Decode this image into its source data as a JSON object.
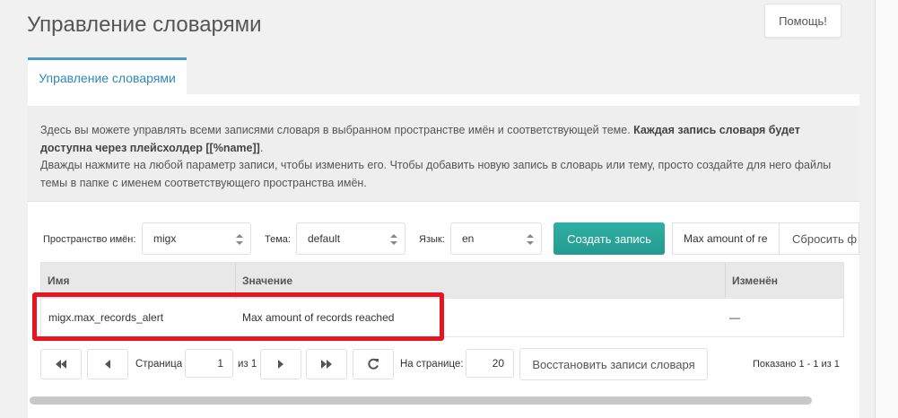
{
  "header": {
    "title": "Управление словарями",
    "help_label": "Помощь!"
  },
  "tabs": [
    {
      "label": "Управление словарями",
      "active": true
    }
  ],
  "description": {
    "line1_regular": "Здесь вы можете управлять всеми записями словаря в выбранном пространстве имён и соответствующей теме. ",
    "line1_bold": "Каждая запись словаря будет доступна через плейсхолдер [[%name]]",
    "line1_end": ".",
    "line2": "Дважды нажмите на любой параметр записи, чтобы изменить его. Чтобы добавить новую запись в словарь или тему, просто создайте для него файлы темы в папке с именем соответствующего пространства имён."
  },
  "filters": {
    "namespace_label": "Пространство имён:",
    "namespace_value": "migx",
    "theme_label": "Тема:",
    "theme_value": "default",
    "language_label": "Язык:",
    "language_value": "en",
    "create_label": "Создать запись",
    "search_value": "Max amount of re",
    "reset_label": "Сбросить ф"
  },
  "grid": {
    "columns": [
      "Имя",
      "Значение",
      "Изменён"
    ],
    "rows": [
      {
        "name": "migx.max_records_alert",
        "value": "Max amount of records reached",
        "modified": "—"
      }
    ]
  },
  "pager": {
    "page_label": "Страница",
    "page_value": "1",
    "of_label": "из 1",
    "per_page_label": "На странице:",
    "per_page_value": "20",
    "restore_label": "Восстановить записи словаря",
    "shown_label": "Показано 1 - 1 из 1"
  },
  "colors": {
    "accent_tab": "#4d9ac9",
    "create_button": "#2aa59a",
    "highlight": "#e5161f"
  }
}
